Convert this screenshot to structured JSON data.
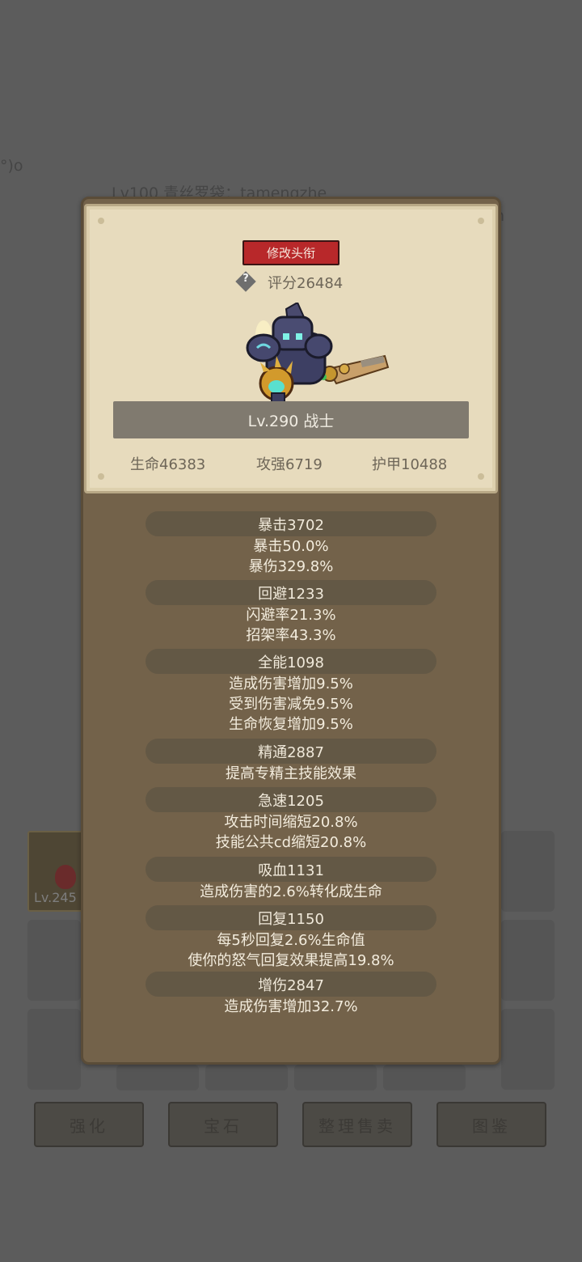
{
  "background": {
    "left_text": "°)o",
    "top_text": "Lv100 青丝罗袋：tamengzhe",
    "right_text": "n",
    "item_level": "Lv.245",
    "buttons": [
      "强化",
      "宝石",
      "整理售卖",
      "图鉴"
    ]
  },
  "header": {
    "rename_label": "修改头衔",
    "help_icon": "question-diamond-icon",
    "score": "评分26484",
    "level_class": "Lv.290 战士",
    "stats": {
      "hp": "生命46383",
      "attack": "攻强6719",
      "armor": "护甲10488"
    }
  },
  "stats": [
    {
      "name": "暴击3702",
      "lines": [
        "暴击50.0%",
        "暴伤329.8%"
      ]
    },
    {
      "name": "回避1233",
      "lines": [
        "闪避率21.3%",
        "招架率43.3%"
      ]
    },
    {
      "name": "全能1098",
      "lines": [
        "造成伤害增加9.5%",
        "受到伤害减免9.5%",
        "生命恢复增加9.5%"
      ]
    },
    {
      "name": "精通2887",
      "lines": [
        "提高专精主技能效果"
      ]
    },
    {
      "name": "急速1205",
      "lines": [
        "攻击时间缩短20.8%",
        "技能公共cd缩短20.8%"
      ]
    },
    {
      "name": "吸血1131",
      "lines": [
        "造成伤害的2.6%转化成生命"
      ]
    },
    {
      "name": "回复1150",
      "lines": [
        "每5秒回复2.6%生命值",
        "使你的怒气回复效果提高19.8%"
      ]
    },
    {
      "name": "增伤2847",
      "lines": [
        "造成伤害增加32.7%"
      ]
    }
  ],
  "colors": {
    "rename_button": "#b8282a",
    "panel": "#73624a",
    "parchment": "#e7dbbd"
  }
}
